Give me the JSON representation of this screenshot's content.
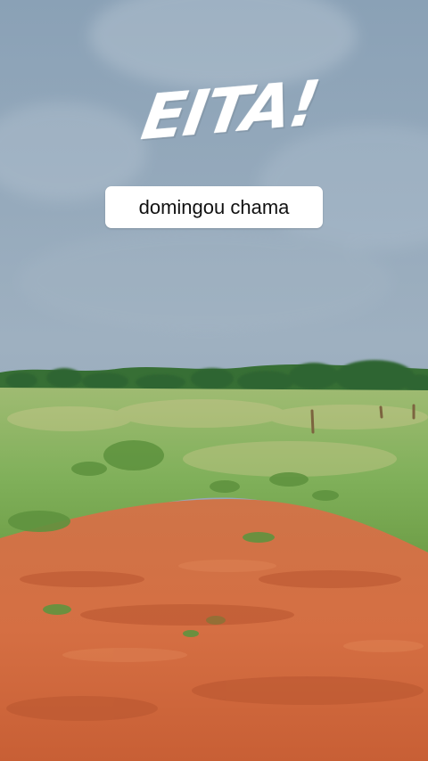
{
  "overlay": {
    "title": "EITA!",
    "caption": "domingou chama"
  },
  "scene": {
    "subjects": [
      "cloudy sky",
      "tree line",
      "green field",
      "red dirt ground"
    ],
    "colors": {
      "sky": "#8fa4b7",
      "grass": "#86b15d",
      "dirt": "#d46e42",
      "trees": "#2f6f35"
    }
  }
}
